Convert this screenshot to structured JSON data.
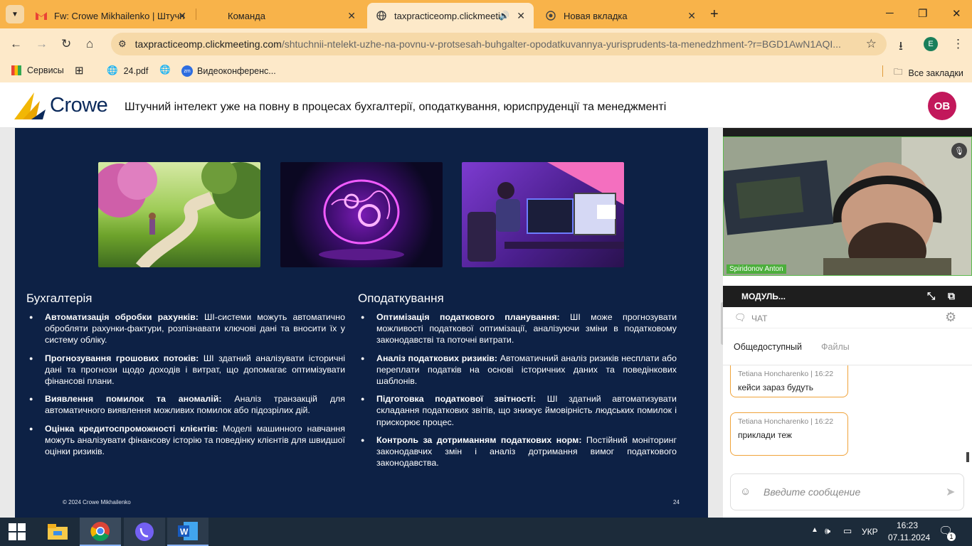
{
  "browser": {
    "tabs": [
      {
        "title": "Fw: Crowe Mikhailenko | Штучн",
        "icon": "gmail-icon"
      },
      {
        "title": "Команда",
        "icon": "none"
      },
      {
        "title": "taxpracticeomp.clickmeetin",
        "icon": "globe-icon"
      },
      {
        "title": "Новая вкладка",
        "icon": "chrome-icon"
      }
    ],
    "new_tab": "+",
    "url_host": "taxpracticeomp.clickmeeting.com",
    "url_path": "/shtuchnii-ntelekt-uzhe-na-povnu-v-protsesah-buhgalter-opodatkuvannya-yurisprudents-ta-menedzhment-?r=BGD1AwN1AQI...",
    "profile_letter": "E",
    "bookmarks": [
      "Сервисы",
      "24.pdf",
      "Видеоконференс..."
    ],
    "all_bookmarks": "Все закладки"
  },
  "header": {
    "logo": "Crowe",
    "title": "Штучний інтелект уже на повну в процесах бухгалтерії, оподаткування, юриспруденції та менеджменті",
    "avatar": "ОВ"
  },
  "slide": {
    "left": {
      "heading": "Бухгалтерія",
      "items": [
        {
          "bold": "Автоматизація обробки рахунків:",
          "text": " ШІ-системи можуть автоматично обробляти рахунки-фактури, розпізнавати ключові дані та вносити їх у систему обліку."
        },
        {
          "bold": "Прогнозування грошових потоків:",
          "text": " ШІ здатний аналізувати історичні дані та прогнози щодо доходів і витрат, що допомагає оптимізувати фінансові плани."
        },
        {
          "bold": "Виявлення помилок та аномалій:",
          "text": " Аналіз транзакцій для автоматичного виявлення можливих помилок або підозрілих дій."
        },
        {
          "bold": "Оцінка кредитоспроможності клієнтів:",
          "text": " Моделі машинного навчання можуть аналізувати фінансову історію та поведінку клієнтів для швидшої оцінки ризиків."
        }
      ]
    },
    "right": {
      "heading": "Оподаткування",
      "items": [
        {
          "bold": "Оптимізація податкового планування:",
          "text": " ШІ може прогнозувати можливості податкової оптимізації, аналізуючи зміни в податковому законодавстві та поточні витрати."
        },
        {
          "bold": "Аналіз податкових ризиків:",
          "text": " Автоматичний аналіз ризиків несплати або переплати податків на основі історичних даних та поведінкових шаблонів."
        },
        {
          "bold": "Підготовка податкової звітності:",
          "text": " ШІ здатний автоматизувати складання податкових звітів, що знижує ймовірність людських помилок і прискорює процес."
        },
        {
          "bold": "Контроль за дотриманням податкових норм:",
          "text": " Постійний моніторинг законодавчих змін і аналіз дотримання вимог податкового законодавства."
        }
      ]
    },
    "copyright": "© 2024 Crowe Mikhailenko",
    "page_number": "24"
  },
  "sidebar": {
    "speaker_name": "Spiridonov Anton",
    "module_label": "МОДУЛЬ...",
    "chat_label": "ЧАТ",
    "tabs": [
      "Общедоступный",
      "Файлы"
    ],
    "messages": [
      {
        "author": "Tetiana Honcharenko",
        "time": "16:22",
        "text": "кейси зараз будуть"
      },
      {
        "author": "Tetiana Honcharenko",
        "time": "16:22",
        "text": "приклади теж"
      }
    ],
    "input_placeholder": "Введите сообщение"
  },
  "taskbar": {
    "lang": "УКР",
    "time": "16:23",
    "date": "07.11.2024",
    "notifications": "1"
  }
}
